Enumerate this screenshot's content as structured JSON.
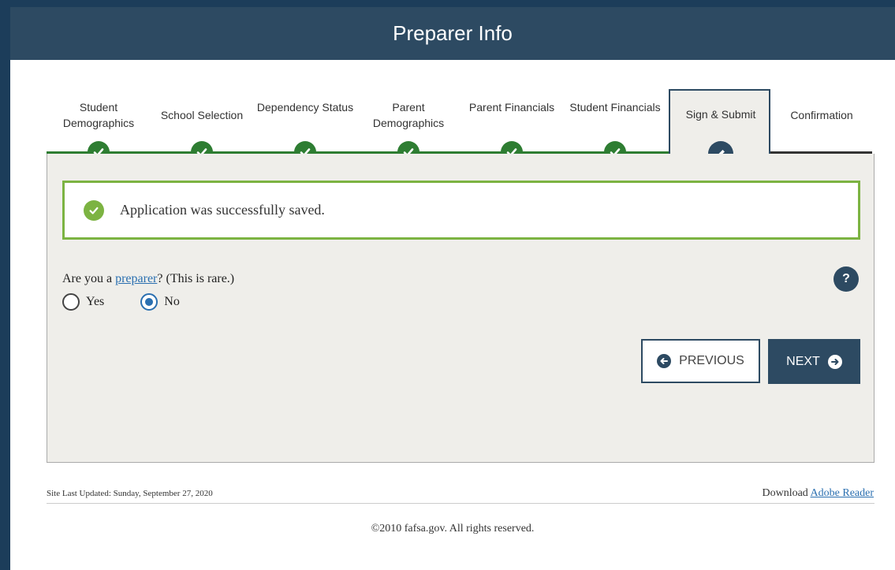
{
  "header": {
    "title": "Preparer Info"
  },
  "steps": [
    {
      "label": "Student Demographics",
      "status": "complete"
    },
    {
      "label": "School Selection",
      "status": "complete"
    },
    {
      "label": "Dependency Status",
      "status": "complete"
    },
    {
      "label": "Parent Demographics",
      "status": "complete"
    },
    {
      "label": "Parent Financials",
      "status": "complete"
    },
    {
      "label": "Student Financials",
      "status": "complete"
    },
    {
      "label": "Sign & Submit",
      "status": "active"
    },
    {
      "label": "Confirmation",
      "status": "pending"
    }
  ],
  "alert": {
    "message": "Application was successfully saved."
  },
  "question": {
    "prefix": "Are you a",
    "link": "preparer",
    "suffix": "? (This is rare.)",
    "help": "?"
  },
  "options": {
    "yes": "Yes",
    "no": "No",
    "selected": "No"
  },
  "buttons": {
    "previous": "PREVIOUS",
    "next": "NEXT"
  },
  "footer": {
    "updated": "Site Last Updated: Sunday, September 27, 2020",
    "download_prefix": "Download",
    "download_link": "Adobe Reader",
    "copyright": "©2010 fafsa.gov. All rights reserved."
  },
  "colors": {
    "header": "#2d4a62",
    "complete": "#2e7d32",
    "success_border": "#7cb342",
    "link": "#2a6fb0"
  }
}
